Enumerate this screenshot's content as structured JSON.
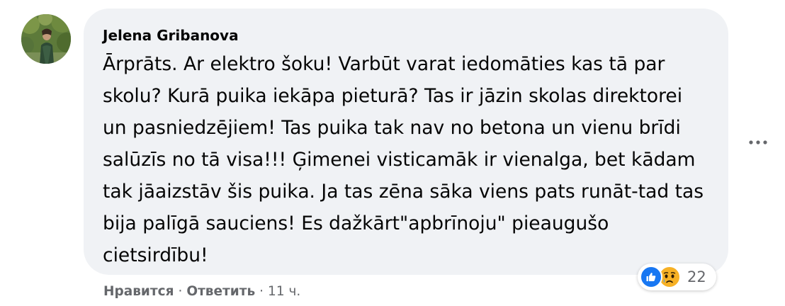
{
  "comment": {
    "author": "Jelena Gribanova",
    "text": "Ārprāts. Ar elektro šoku! Varbūt varat iedomāties kas tā par skolu? Kurā puika iekāpa pieturā? Tas ir jāzin skolas direktorei un pasniedzējiem! Tas puika tak nav no betona un vienu brīdi salūzīs no tā visa!!! Ģimenei visticamāk ir vienalga, bet kādam tak jāaizstāv šis puika. Ja tas zēna sāka viens pats runāt-tad tas bija palīgā sauciens! Es dažkārt\"apbrīnoju\" pieaugušo cietsirdību!",
    "reactions": {
      "icons": [
        "like-icon",
        "sad-icon"
      ],
      "count": "22"
    },
    "actions": {
      "like_label": "Нравится",
      "reply_label": "Ответить",
      "separator": "·",
      "timestamp": "11 ч."
    },
    "more_icon": "more-horizontal-icon"
  },
  "colors": {
    "bubble_bg": "#f0f2f5",
    "text": "#050505",
    "secondary_text": "#65676b",
    "like_blue": "#1877f2",
    "sad_yellow": "#f7b125"
  }
}
